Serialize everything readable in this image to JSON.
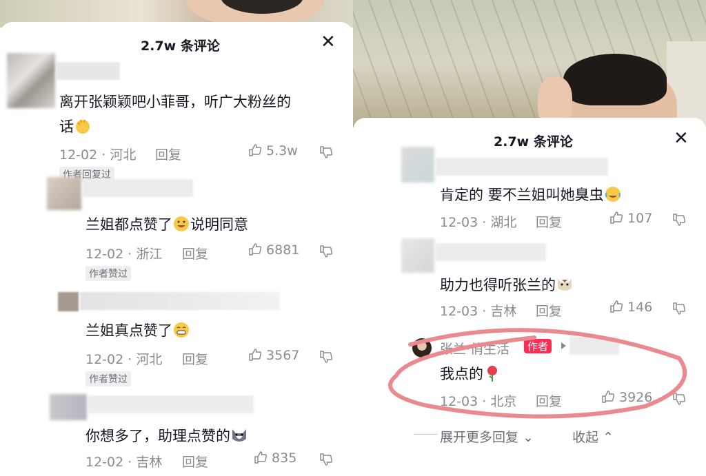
{
  "left_panel": {
    "title": "2.7w 条评论",
    "comments": [
      {
        "text": "离开张颖颖吧小菲哥，听广大粉丝的",
        "text2": "话",
        "date": "12-02",
        "location": "河北",
        "reply": "回复",
        "likes": "5.3w",
        "tag": "作者回复过"
      },
      {
        "text": "兰姐都点赞了",
        "text_after": "说明同意",
        "date": "12-02",
        "location": "浙江",
        "reply": "回复",
        "likes": "6881",
        "tag": "作者赞过"
      },
      {
        "text": "兰姐真点赞了",
        "date": "12-02",
        "location": "河北",
        "reply": "回复",
        "likes": "3567",
        "tag": "作者赞过"
      },
      {
        "text": "你想多了，助理点赞的",
        "date": "12-02",
        "location": "吉林",
        "reply": "回复",
        "likes": "835"
      }
    ]
  },
  "right_panel": {
    "title": "2.7w 条评论",
    "comments": [
      {
        "text": "肯定的 要不兰姐叫她臭虫",
        "date": "12-03",
        "location": "湖北",
        "reply": "回复",
        "likes": "107"
      },
      {
        "text": "助力也得听张兰的",
        "date": "12-03",
        "location": "吉林",
        "reply": "回复",
        "likes": "146"
      },
      {
        "author": "张兰·俏生活",
        "badge": "作者",
        "text": "我点的",
        "date": "12-03",
        "location": "北京",
        "reply": "回复",
        "likes": "3926"
      }
    ],
    "expand_label": "展开更多回复",
    "collapse_label": "收起"
  },
  "colors": {
    "text": "#161823",
    "meta": "#8a8b91",
    "badge": "#fe2c55",
    "annotation": "#e98a8f"
  }
}
